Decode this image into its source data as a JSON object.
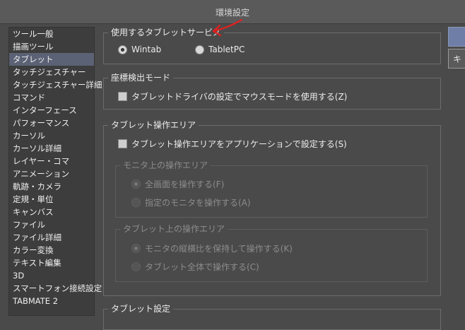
{
  "window": {
    "title": "環境設定"
  },
  "sidebar": {
    "items": [
      {
        "label": "ツール一般"
      },
      {
        "label": "描画ツール"
      },
      {
        "label": "タブレット"
      },
      {
        "label": "タッチジェスチャー"
      },
      {
        "label": "タッチジェスチャー詳細"
      },
      {
        "label": "コマンド"
      },
      {
        "label": "インターフェース"
      },
      {
        "label": "パフォーマンス"
      },
      {
        "label": "カーソル"
      },
      {
        "label": "カーソル詳細"
      },
      {
        "label": "レイヤー・コマ"
      },
      {
        "label": "アニメーション"
      },
      {
        "label": "軌跡・カメラ"
      },
      {
        "label": "定規・単位"
      },
      {
        "label": "キャンバス"
      },
      {
        "label": "ファイル"
      },
      {
        "label": "ファイル詳細"
      },
      {
        "label": "カラー変換"
      },
      {
        "label": "テキスト編集"
      },
      {
        "label": "3D"
      },
      {
        "label": "スマートフォン接続設定"
      },
      {
        "label": "TABMATE 2"
      }
    ],
    "selected": "タブレット"
  },
  "service_group": {
    "title": "使用するタブレットサービス",
    "options": [
      {
        "label": "Wintab"
      },
      {
        "label": "TabletPC"
      }
    ],
    "selected": "Wintab"
  },
  "coord_group": {
    "title": "座標検出モード",
    "checkbox_label": "タブレットドライバの設定でマウスモードを使用する(Z)"
  },
  "area_group": {
    "title": "タブレット操作エリア",
    "checkbox_label": "タブレット操作エリアをアプリケーションで設定する(S)",
    "monitor": {
      "title": "モニタ上の操作エリア",
      "options": [
        {
          "label": "全画面を操作する(F)"
        },
        {
          "label": "指定のモニタを操作する(A)"
        }
      ]
    },
    "tablet": {
      "title": "タブレット上の操作エリア",
      "options": [
        {
          "label": "モニタの縦横比を保持して操作する(K)"
        },
        {
          "label": "タブレット全体で操作する(C)"
        }
      ]
    }
  },
  "settings_group": {
    "title": "タブレット設定"
  },
  "buttons": {
    "second_glyph": "キ"
  },
  "colors": {
    "annotation_arrow": "#e02020",
    "selection": "#5b6275"
  }
}
